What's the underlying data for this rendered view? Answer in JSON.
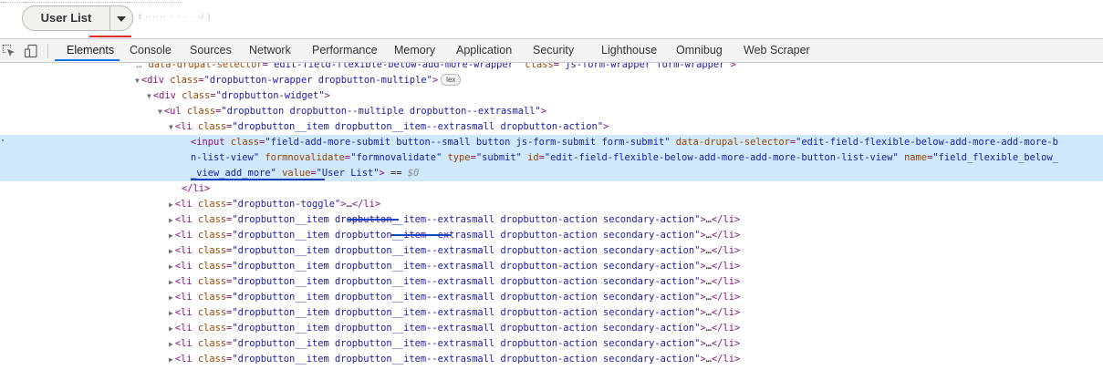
{
  "page": {
    "dropbutton_label": "User List",
    "blurred_text": "t  ······ ·      · ·  ·  ·/ )"
  },
  "devtools": {
    "tabs": [
      "Elements",
      "Console",
      "Sources",
      "Network",
      "Performance",
      "Memory",
      "Application",
      "Security",
      "Lighthouse",
      "Omnibug",
      "Web Scraper"
    ],
    "active_tab": "Elements",
    "icons": [
      "inspect-element-icon",
      "device-toolbar-icon"
    ]
  },
  "dom_lines": [
    {
      "indent": 150,
      "arrow": "",
      "segments": [
        [
          "dim",
          "…"
        ],
        [
          "attr",
          " data-drupal-selector"
        ],
        [
          "punc",
          "="
        ],
        [
          "val",
          "\"edit-field-flexible-below-add-more-wrapper\""
        ],
        [
          "attr",
          " class"
        ],
        [
          "punc",
          "="
        ],
        [
          "val",
          "\"js-form-wrapper form-wrapper\""
        ],
        [
          "punc",
          ">"
        ]
      ]
    },
    {
      "indent": 150,
      "arrow": "▼",
      "segments": [
        [
          "tag",
          "<div"
        ],
        [
          "attr",
          " class"
        ],
        [
          "punc",
          "="
        ],
        [
          "val",
          "\"dropbutton-wrapper dropbutton-multiple\""
        ],
        [
          "tag",
          ">"
        ]
      ],
      "badge": "lex"
    },
    {
      "indent": 163,
      "arrow": "▼",
      "segments": [
        [
          "tag",
          "<div"
        ],
        [
          "attr",
          " class"
        ],
        [
          "punc",
          "="
        ],
        [
          "val",
          "\"dropbutton-widget\""
        ],
        [
          "tag",
          ">"
        ]
      ]
    },
    {
      "indent": 175,
      "arrow": "▼",
      "segments": [
        [
          "tag",
          "<ul"
        ],
        [
          "attr",
          " class"
        ],
        [
          "punc",
          "="
        ],
        [
          "val",
          "\"dropbutton dropbutton--multiple dropbutton--extrasmall\""
        ],
        [
          "tag",
          ">"
        ]
      ]
    },
    {
      "indent": 187,
      "arrow": "▼",
      "segments": [
        [
          "tag",
          "<li"
        ],
        [
          "attr",
          " class"
        ],
        [
          "punc",
          "="
        ],
        [
          "val",
          "\"dropbutton__item dropbutton__item--extrasmall dropbutton-action\""
        ],
        [
          "tag",
          ">"
        ]
      ]
    },
    {
      "indent": 209,
      "arrow": "",
      "selected": true,
      "segments": [
        [
          "tag",
          "<input"
        ],
        [
          "attr",
          " class"
        ],
        [
          "punc",
          "="
        ],
        [
          "val",
          "\"field-add-more-submit button--small button js-form-submit form-submit\""
        ],
        [
          "attr",
          " data-drupal-selector"
        ],
        [
          "punc",
          "="
        ],
        [
          "val",
          "\"edit-field-flexible-below-add-more-add-more-b"
        ]
      ]
    },
    {
      "indent": 209,
      "arrow": "",
      "selected": true,
      "segments": [
        [
          "val",
          "n-list-view\""
        ],
        [
          "attr",
          " formnovalidate"
        ],
        [
          "punc",
          "="
        ],
        [
          "val",
          "\"formnovalidate\""
        ],
        [
          "attr",
          " type"
        ],
        [
          "punc",
          "="
        ],
        [
          "val",
          "\"submit\""
        ],
        [
          "attr",
          " id"
        ],
        [
          "punc",
          "="
        ],
        [
          "val",
          "\"edit-field-flexible-below-add-more-add-more-button-list-view\""
        ],
        [
          "attr",
          " name"
        ],
        [
          "punc",
          "="
        ],
        [
          "val",
          "\"field_flexible_below_"
        ]
      ]
    },
    {
      "indent": 209,
      "arrow": "",
      "selected": true,
      "segments": [
        [
          "val",
          "_view_add_more\""
        ],
        [
          "attr",
          " value"
        ],
        [
          "punc",
          "="
        ],
        [
          "val",
          "\"User List\""
        ],
        [
          "tag",
          ">"
        ],
        [
          "txt",
          " == "
        ],
        [
          "dim",
          "$0"
        ]
      ]
    },
    {
      "indent": 199,
      "arrow": "",
      "segments": [
        [
          "tag",
          "</li>"
        ]
      ]
    },
    {
      "indent": 187,
      "arrow": "▶",
      "segments": [
        [
          "tag",
          "<li"
        ],
        [
          "attr",
          " class"
        ],
        [
          "punc",
          "="
        ],
        [
          "val",
          "\"dropbutton-toggle\""
        ],
        [
          "tag",
          ">"
        ],
        [
          "txt",
          "…"
        ],
        [
          "tag",
          "</li>"
        ]
      ]
    },
    {
      "indent": 187,
      "arrow": "▶",
      "segments": [
        [
          "tag",
          "<li"
        ],
        [
          "attr",
          " class"
        ],
        [
          "punc",
          "="
        ],
        [
          "val",
          "\"dropbutton__item dropbutton__item--extrasmall dropbutton-action secondary-action\""
        ],
        [
          "tag",
          ">"
        ],
        [
          "txt",
          "…"
        ],
        [
          "tag",
          "</li>"
        ]
      ]
    },
    {
      "indent": 187,
      "arrow": "▶",
      "segments": [
        [
          "tag",
          "<li"
        ],
        [
          "attr",
          " class"
        ],
        [
          "punc",
          "="
        ],
        [
          "val",
          "\"dropbutton__item dropbutton__item--extrasmall dropbutton-action secondary-action\""
        ],
        [
          "tag",
          ">"
        ],
        [
          "txt",
          "…"
        ],
        [
          "tag",
          "</li>"
        ]
      ]
    },
    {
      "indent": 187,
      "arrow": "▶",
      "segments": [
        [
          "tag",
          "<li"
        ],
        [
          "attr",
          " class"
        ],
        [
          "punc",
          "="
        ],
        [
          "val",
          "\"dropbutton__item dropbutton__item--extrasmall dropbutton-action secondary-action\""
        ],
        [
          "tag",
          ">"
        ],
        [
          "txt",
          "…"
        ],
        [
          "tag",
          "</li>"
        ]
      ]
    },
    {
      "indent": 187,
      "arrow": "▶",
      "segments": [
        [
          "tag",
          "<li"
        ],
        [
          "attr",
          " class"
        ],
        [
          "punc",
          "="
        ],
        [
          "val",
          "\"dropbutton__item dropbutton__item--extrasmall dropbutton-action secondary-action\""
        ],
        [
          "tag",
          ">"
        ],
        [
          "txt",
          "…"
        ],
        [
          "tag",
          "</li>"
        ]
      ]
    },
    {
      "indent": 187,
      "arrow": "▶",
      "segments": [
        [
          "tag",
          "<li"
        ],
        [
          "attr",
          " class"
        ],
        [
          "punc",
          "="
        ],
        [
          "val",
          "\"dropbutton__item dropbutton__item--extrasmall dropbutton-action secondary-action\""
        ],
        [
          "tag",
          ">"
        ],
        [
          "txt",
          "…"
        ],
        [
          "tag",
          "</li>"
        ]
      ]
    },
    {
      "indent": 187,
      "arrow": "▶",
      "segments": [
        [
          "tag",
          "<li"
        ],
        [
          "attr",
          " class"
        ],
        [
          "punc",
          "="
        ],
        [
          "val",
          "\"dropbutton__item dropbutton__item--extrasmall dropbutton-action secondary-action\""
        ],
        [
          "tag",
          ">"
        ],
        [
          "txt",
          "…"
        ],
        [
          "tag",
          "</li>"
        ]
      ]
    },
    {
      "indent": 187,
      "arrow": "▶",
      "segments": [
        [
          "tag",
          "<li"
        ],
        [
          "attr",
          " class"
        ],
        [
          "punc",
          "="
        ],
        [
          "val",
          "\"dropbutton__item dropbutton__item--extrasmall dropbutton-action secondary-action\""
        ],
        [
          "tag",
          ">"
        ],
        [
          "txt",
          "…"
        ],
        [
          "tag",
          "</li>"
        ]
      ]
    },
    {
      "indent": 187,
      "arrow": "▶",
      "segments": [
        [
          "tag",
          "<li"
        ],
        [
          "attr",
          " class"
        ],
        [
          "punc",
          "="
        ],
        [
          "val",
          "\"dropbutton__item dropbutton__item--extrasmall dropbutton-action secondary-action\""
        ],
        [
          "tag",
          ">"
        ],
        [
          "txt",
          "…"
        ],
        [
          "tag",
          "</li>"
        ]
      ]
    },
    {
      "indent": 187,
      "arrow": "▶",
      "segments": [
        [
          "tag",
          "<li"
        ],
        [
          "attr",
          " class"
        ],
        [
          "punc",
          "="
        ],
        [
          "val",
          "\"dropbutton__item dropbutton__item--extrasmall dropbutton-action secondary-action\""
        ],
        [
          "tag",
          ">"
        ],
        [
          "txt",
          "…"
        ],
        [
          "tag",
          "</li>"
        ]
      ]
    },
    {
      "indent": 187,
      "arrow": "▶",
      "segments": [
        [
          "tag",
          "<li"
        ],
        [
          "attr",
          " class"
        ],
        [
          "punc",
          "="
        ],
        [
          "val",
          "\"dropbutton__item dropbutton__item--extrasmall dropbutton-action secondary-action\""
        ],
        [
          "tag",
          ">"
        ],
        [
          "txt",
          "…"
        ],
        [
          "tag",
          "</li>"
        ]
      ]
    },
    {
      "indent": 187,
      "arrow": "▶",
      "segments": [
        [
          "tag",
          "<li"
        ],
        [
          "attr",
          " class"
        ],
        [
          "punc",
          "="
        ],
        [
          "val",
          "\"dropbutton__item dropbutton__item--extrasmall dropbutton-action secondary-action\""
        ],
        [
          "tag",
          ">"
        ],
        [
          "txt",
          "…"
        ],
        [
          "tag",
          "</li>"
        ]
      ]
    }
  ],
  "colors": {
    "selection_bg": "#cfe8fc",
    "tag": "#881280",
    "attr": "#994500",
    "value": "#1a1aa6",
    "active_tab_underline": "#1a73e8",
    "annotation_blue": "#1a3fc2",
    "annotation_red": "#d93025"
  }
}
